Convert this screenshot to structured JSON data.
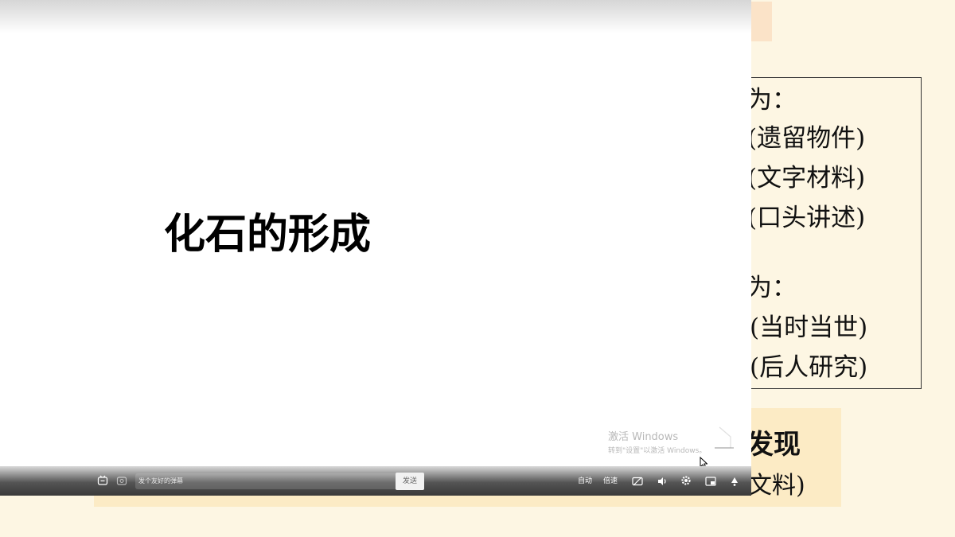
{
  "slide_main": {
    "title": "化石的形成"
  },
  "background_slide": {
    "box_lines": [
      "为：",
      "(遗留物件)",
      "(文字材料)",
      "(口头讲述)",
      "为：",
      "料(当时当世)",
      "料(后人研究)"
    ],
    "bottom_big": "发现",
    "bottom_small": "文料)"
  },
  "watermark": {
    "line1": "激活 Windows",
    "line2": "转到\"设置\"以激活 Windows。"
  },
  "controls": {
    "danmu_placeholder": "发个友好的弹幕",
    "send_label": "发送",
    "auto_label": "自动",
    "speed_label": "倍速"
  }
}
